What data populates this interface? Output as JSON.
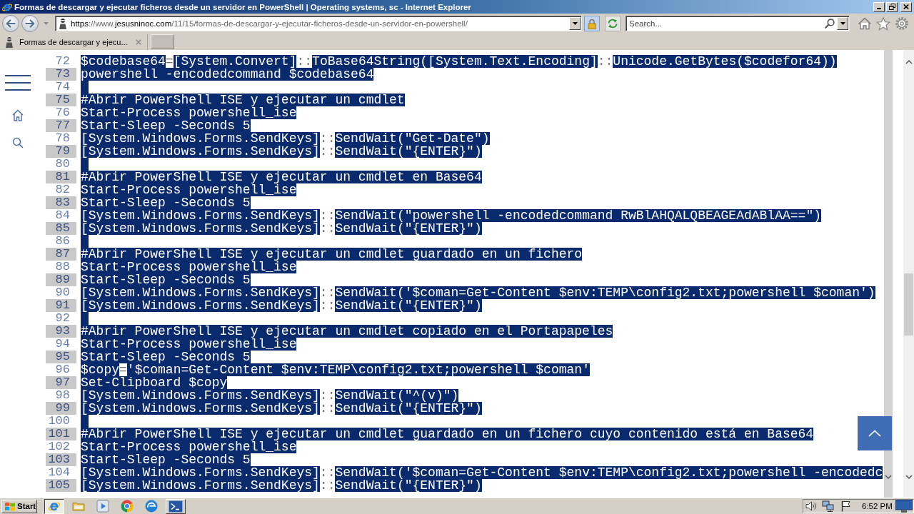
{
  "window": {
    "title": "Formas de descargar y ejecutar ficheros desde un servidor en PowerShell | Operating systems, sc - Internet Explorer"
  },
  "address_bar": {
    "url": [
      {
        "text": "https",
        "highlighted": true
      },
      {
        "text": "://www.",
        "highlighted": false
      },
      {
        "text": "jesusninoc.com",
        "highlighted": true
      },
      {
        "text": "/11/15/formas-de-descargar-y-ejecutar-ficheros-desde-un-servidor-en-powershell/",
        "highlighted": false
      }
    ]
  },
  "search": {
    "placeholder": "Search..."
  },
  "tabs": [
    {
      "label": "Formas de descargar y ejecu...",
      "selected": true
    }
  ],
  "code": {
    "lines": [
      {
        "number": "72",
        "segments": [
          {
            "text": "$codebase64",
            "selected": true
          },
          {
            "text": "=",
            "selected": false
          },
          {
            "text": "[System.Convert]",
            "selected": true
          },
          {
            "text": "::",
            "selected": false
          },
          {
            "text": "ToBase64String([System.Text.Encoding]",
            "selected": true
          },
          {
            "text": "::",
            "selected": false
          },
          {
            "text": "Unicode.GetBytes($codefor64))",
            "selected": true
          }
        ]
      },
      {
        "number": "73",
        "segments": [
          {
            "text": "powershell -encodedcommand $codebase64",
            "selected": true
          }
        ]
      },
      {
        "number": "74",
        "selected": true
      },
      {
        "number": "75",
        "segments": [
          {
            "text": "#Abrir PowerShell ISE y ejecutar un cmdlet",
            "selected": true
          }
        ]
      },
      {
        "number": "76",
        "segments": [
          {
            "text": "Start-Process powershell_ise",
            "selected": true
          }
        ]
      },
      {
        "number": "77",
        "segments": [
          {
            "text": "Start-Sleep -Seconds 5",
            "selected": true
          }
        ]
      },
      {
        "number": "78",
        "segments": [
          {
            "text": "[System.Windows.Forms.SendKeys]",
            "selected": true
          },
          {
            "text": "::",
            "selected": false
          },
          {
            "text": "SendWait(\"Get-Date\")",
            "selected": true
          }
        ]
      },
      {
        "number": "79",
        "segments": [
          {
            "text": "[System.Windows.Forms.SendKeys]",
            "selected": true
          },
          {
            "text": "::",
            "selected": false
          },
          {
            "text": "SendWait(\"{ENTER}\")",
            "selected": true
          }
        ]
      },
      {
        "number": "80",
        "selected": true
      },
      {
        "number": "81",
        "segments": [
          {
            "text": "#Abrir PowerShell ISE y ejecutar un cmdlet en Base64",
            "selected": true
          }
        ]
      },
      {
        "number": "82",
        "segments": [
          {
            "text": "Start-Process powershell_ise",
            "selected": true
          }
        ]
      },
      {
        "number": "83",
        "segments": [
          {
            "text": "Start-Sleep -Seconds 5",
            "selected": true
          }
        ]
      },
      {
        "number": "84",
        "segments": [
          {
            "text": "[System.Windows.Forms.SendKeys]",
            "selected": true
          },
          {
            "text": "::",
            "selected": false
          },
          {
            "text": "SendWait(\"powershell -encodedcommand RwBlAHQALQBEAGEAdABlAA==\")",
            "selected": true
          }
        ]
      },
      {
        "number": "85",
        "segments": [
          {
            "text": "[System.Windows.Forms.SendKeys]",
            "selected": true
          },
          {
            "text": "::",
            "selected": false
          },
          {
            "text": "SendWait(\"{ENTER}\")",
            "selected": true
          }
        ]
      },
      {
        "number": "86",
        "selected": true
      },
      {
        "number": "87",
        "segments": [
          {
            "text": "#Abrir PowerShell ISE y ejecutar un cmdlet guardado en un fichero",
            "selected": true
          }
        ]
      },
      {
        "number": "88",
        "segments": [
          {
            "text": "Start-Process powershell_ise",
            "selected": true
          }
        ]
      },
      {
        "number": "89",
        "segments": [
          {
            "text": "Start-Sleep -Seconds 5",
            "selected": true
          }
        ]
      },
      {
        "number": "90",
        "segments": [
          {
            "text": "[System.Windows.Forms.SendKeys]",
            "selected": true
          },
          {
            "text": "::",
            "selected": false
          },
          {
            "text": "SendWait('$coman=Get-Content $env:TEMP\\config2.txt;powershell $coman')",
            "selected": true
          }
        ]
      },
      {
        "number": "91",
        "segments": [
          {
            "text": "[System.Windows.Forms.SendKeys]",
            "selected": true
          },
          {
            "text": "::",
            "selected": false
          },
          {
            "text": "SendWait(\"{ENTER}\")",
            "selected": true
          }
        ]
      },
      {
        "number": "92",
        "selected": true
      },
      {
        "number": "93",
        "segments": [
          {
            "text": "#Abrir PowerShell ISE y ejecutar un cmdlet copiado en el Portapapeles",
            "selected": true
          }
        ]
      },
      {
        "number": "94",
        "segments": [
          {
            "text": "Start-Process powershell_ise",
            "selected": true
          }
        ]
      },
      {
        "number": "95",
        "segments": [
          {
            "text": "Start-Sleep -Seconds 5",
            "selected": true
          }
        ]
      },
      {
        "number": "96",
        "segments": [
          {
            "text": "$copy",
            "selected": true
          },
          {
            "text": "=",
            "selected": false
          },
          {
            "text": "'$coman=Get-Content $env:TEMP\\config2.txt;powershell $coman'",
            "selected": true
          }
        ]
      },
      {
        "number": "97",
        "segments": [
          {
            "text": "Set-Clipboard $copy",
            "selected": true
          }
        ]
      },
      {
        "number": "98",
        "segments": [
          {
            "text": "[System.Windows.Forms.SendKeys]",
            "selected": true
          },
          {
            "text": "::",
            "selected": false
          },
          {
            "text": "SendWait(\"^(v)\")",
            "selected": true
          }
        ]
      },
      {
        "number": "99",
        "segments": [
          {
            "text": "[System.Windows.Forms.SendKeys]",
            "selected": true
          },
          {
            "text": "::",
            "selected": false
          },
          {
            "text": "SendWait(\"{ENTER}\")",
            "selected": true
          }
        ]
      },
      {
        "number": "100",
        "selected": true
      },
      {
        "number": "101",
        "segments": [
          {
            "text": "#Abrir PowerShell ISE y ejecutar un cmdlet guardado en un fichero cuyo contenido está en Base64",
            "selected": true
          }
        ]
      },
      {
        "number": "102",
        "segments": [
          {
            "text": "Start-Process powershell_ise",
            "selected": true
          }
        ]
      },
      {
        "number": "103",
        "segments": [
          {
            "text": "Start-Sleep -Seconds 5",
            "selected": true
          }
        ]
      },
      {
        "number": "104",
        "segments": [
          {
            "text": "[System.Windows.Forms.SendKeys]",
            "selected": true
          },
          {
            "text": "::",
            "selected": false
          },
          {
            "text": "SendWait('$coman=Get-Content $env:TEMP\\config2.txt;powershell -encodedc",
            "selected": true
          }
        ]
      },
      {
        "number": "105",
        "segments": [
          {
            "text": "[System.Windows.Forms.SendKeys]",
            "selected": true
          },
          {
            "text": "::",
            "selected": false
          },
          {
            "text": "SendWait(\"{ENTER}\")",
            "selected": true
          }
        ]
      }
    ]
  },
  "taskbar": {
    "start": "Start",
    "apps": [
      {
        "kind": "ie",
        "open": true,
        "selected": true
      },
      {
        "kind": "folder",
        "open": false,
        "selected": false
      },
      {
        "kind": "player",
        "open": false,
        "selected": false
      },
      {
        "kind": "chrome",
        "open": false,
        "selected": false
      },
      {
        "kind": "edge",
        "open": false,
        "selected": false
      },
      {
        "kind": "shell",
        "open": true,
        "selected": false
      }
    ],
    "clock": "6:52 PM"
  }
}
